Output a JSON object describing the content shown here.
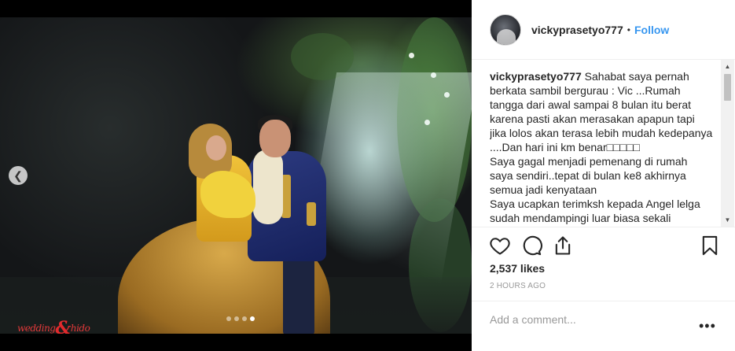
{
  "post": {
    "username": "vickyprasetyo777",
    "separator": "•",
    "follow_label": "Follow",
    "caption_lines": [
      "Sahabat saya pernah berkata sambil bergurau : Vic ...Rumah tangga dari awal sampai 8 bulan itu berat karena pasti akan merasakan apapun tapi jika lolos akan terasa lebih mudah kedepanya ....Dan hari ini km benar□□□□□",
      "Saya gagal menjadi pemenang di rumah saya sendiri..tepat di bulan ke8 akhirnya semua jadi kenyataan",
      "Saya ucapkan terimksh kepada Angel lelga sudah mendampingi luar biasa sekali"
    ],
    "likes": "2,537 likes",
    "time": "2 HOURS AGO",
    "comment_placeholder": "Add a comment...",
    "more_label": "•••"
  },
  "media": {
    "watermark_left": "wedding",
    "watermark_amp": "&",
    "watermark_right": "hido",
    "prev_icon": "chevron-left-icon",
    "carousel_count": 4,
    "carousel_active": 4
  },
  "icons": {
    "like": "heart-icon",
    "comment": "comment-icon",
    "share": "share-icon",
    "save": "bookmark-icon",
    "scroll_up": "scroll-up-arrow-icon",
    "scroll_down": "scroll-down-arrow-icon"
  },
  "colors": {
    "accent": "#3897f0",
    "text": "#262626",
    "muted": "#999999",
    "watermark": "#e0393a"
  }
}
